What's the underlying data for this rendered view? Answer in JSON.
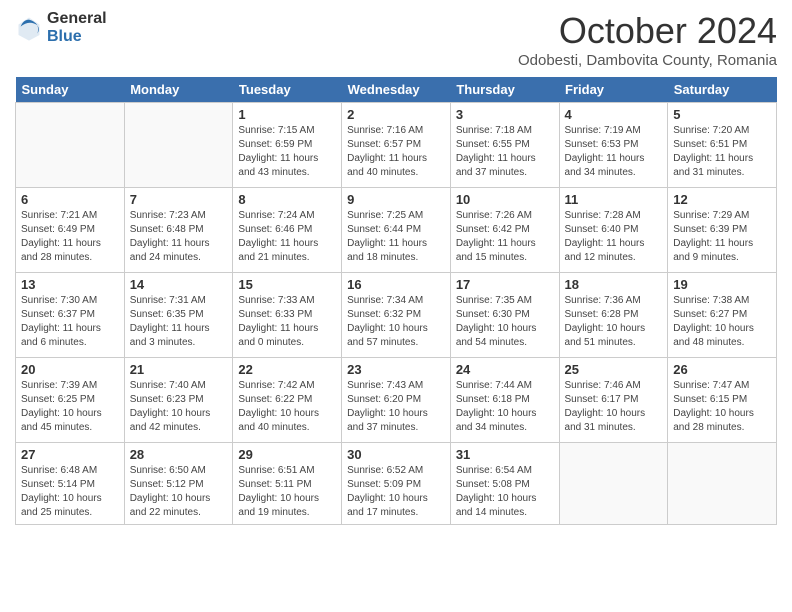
{
  "header": {
    "logo_general": "General",
    "logo_blue": "Blue",
    "month_title": "October 2024",
    "location": "Odobesti, Dambovita County, Romania"
  },
  "days_of_week": [
    "Sunday",
    "Monday",
    "Tuesday",
    "Wednesday",
    "Thursday",
    "Friday",
    "Saturday"
  ],
  "weeks": [
    [
      {
        "day": "",
        "info": ""
      },
      {
        "day": "",
        "info": ""
      },
      {
        "day": "1",
        "info": "Sunrise: 7:15 AM\nSunset: 6:59 PM\nDaylight: 11 hours and 43 minutes."
      },
      {
        "day": "2",
        "info": "Sunrise: 7:16 AM\nSunset: 6:57 PM\nDaylight: 11 hours and 40 minutes."
      },
      {
        "day": "3",
        "info": "Sunrise: 7:18 AM\nSunset: 6:55 PM\nDaylight: 11 hours and 37 minutes."
      },
      {
        "day": "4",
        "info": "Sunrise: 7:19 AM\nSunset: 6:53 PM\nDaylight: 11 hours and 34 minutes."
      },
      {
        "day": "5",
        "info": "Sunrise: 7:20 AM\nSunset: 6:51 PM\nDaylight: 11 hours and 31 minutes."
      }
    ],
    [
      {
        "day": "6",
        "info": "Sunrise: 7:21 AM\nSunset: 6:49 PM\nDaylight: 11 hours and 28 minutes."
      },
      {
        "day": "7",
        "info": "Sunrise: 7:23 AM\nSunset: 6:48 PM\nDaylight: 11 hours and 24 minutes."
      },
      {
        "day": "8",
        "info": "Sunrise: 7:24 AM\nSunset: 6:46 PM\nDaylight: 11 hours and 21 minutes."
      },
      {
        "day": "9",
        "info": "Sunrise: 7:25 AM\nSunset: 6:44 PM\nDaylight: 11 hours and 18 minutes."
      },
      {
        "day": "10",
        "info": "Sunrise: 7:26 AM\nSunset: 6:42 PM\nDaylight: 11 hours and 15 minutes."
      },
      {
        "day": "11",
        "info": "Sunrise: 7:28 AM\nSunset: 6:40 PM\nDaylight: 11 hours and 12 minutes."
      },
      {
        "day": "12",
        "info": "Sunrise: 7:29 AM\nSunset: 6:39 PM\nDaylight: 11 hours and 9 minutes."
      }
    ],
    [
      {
        "day": "13",
        "info": "Sunrise: 7:30 AM\nSunset: 6:37 PM\nDaylight: 11 hours and 6 minutes."
      },
      {
        "day": "14",
        "info": "Sunrise: 7:31 AM\nSunset: 6:35 PM\nDaylight: 11 hours and 3 minutes."
      },
      {
        "day": "15",
        "info": "Sunrise: 7:33 AM\nSunset: 6:33 PM\nDaylight: 11 hours and 0 minutes."
      },
      {
        "day": "16",
        "info": "Sunrise: 7:34 AM\nSunset: 6:32 PM\nDaylight: 10 hours and 57 minutes."
      },
      {
        "day": "17",
        "info": "Sunrise: 7:35 AM\nSunset: 6:30 PM\nDaylight: 10 hours and 54 minutes."
      },
      {
        "day": "18",
        "info": "Sunrise: 7:36 AM\nSunset: 6:28 PM\nDaylight: 10 hours and 51 minutes."
      },
      {
        "day": "19",
        "info": "Sunrise: 7:38 AM\nSunset: 6:27 PM\nDaylight: 10 hours and 48 minutes."
      }
    ],
    [
      {
        "day": "20",
        "info": "Sunrise: 7:39 AM\nSunset: 6:25 PM\nDaylight: 10 hours and 45 minutes."
      },
      {
        "day": "21",
        "info": "Sunrise: 7:40 AM\nSunset: 6:23 PM\nDaylight: 10 hours and 42 minutes."
      },
      {
        "day": "22",
        "info": "Sunrise: 7:42 AM\nSunset: 6:22 PM\nDaylight: 10 hours and 40 minutes."
      },
      {
        "day": "23",
        "info": "Sunrise: 7:43 AM\nSunset: 6:20 PM\nDaylight: 10 hours and 37 minutes."
      },
      {
        "day": "24",
        "info": "Sunrise: 7:44 AM\nSunset: 6:18 PM\nDaylight: 10 hours and 34 minutes."
      },
      {
        "day": "25",
        "info": "Sunrise: 7:46 AM\nSunset: 6:17 PM\nDaylight: 10 hours and 31 minutes."
      },
      {
        "day": "26",
        "info": "Sunrise: 7:47 AM\nSunset: 6:15 PM\nDaylight: 10 hours and 28 minutes."
      }
    ],
    [
      {
        "day": "27",
        "info": "Sunrise: 6:48 AM\nSunset: 5:14 PM\nDaylight: 10 hours and 25 minutes."
      },
      {
        "day": "28",
        "info": "Sunrise: 6:50 AM\nSunset: 5:12 PM\nDaylight: 10 hours and 22 minutes."
      },
      {
        "day": "29",
        "info": "Sunrise: 6:51 AM\nSunset: 5:11 PM\nDaylight: 10 hours and 19 minutes."
      },
      {
        "day": "30",
        "info": "Sunrise: 6:52 AM\nSunset: 5:09 PM\nDaylight: 10 hours and 17 minutes."
      },
      {
        "day": "31",
        "info": "Sunrise: 6:54 AM\nSunset: 5:08 PM\nDaylight: 10 hours and 14 minutes."
      },
      {
        "day": "",
        "info": ""
      },
      {
        "day": "",
        "info": ""
      }
    ]
  ]
}
